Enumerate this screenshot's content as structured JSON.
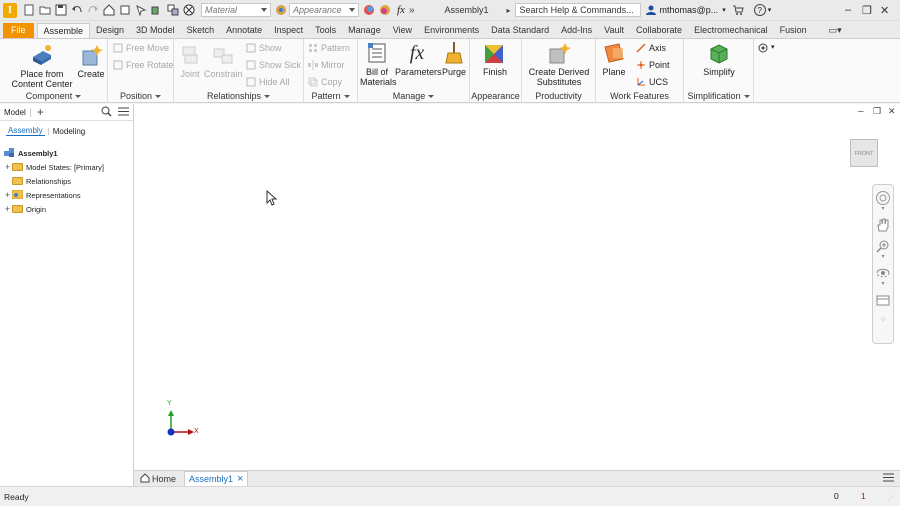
{
  "title_bar": {
    "logo": "I",
    "material_placeholder": "Material",
    "appearance_placeholder": "Appearance",
    "fx": "fx",
    "more": "»",
    "doc_title": "Assembly1",
    "search": "Search Help & Commands...",
    "user": "mthomas@p...",
    "help": "?"
  },
  "tabs": [
    "File",
    "Assemble",
    "Design",
    "3D Model",
    "Sketch",
    "Annotate",
    "Inspect",
    "Tools",
    "Manage",
    "View",
    "Environments",
    "Data Standard",
    "Add-Ins",
    "Vault",
    "Collaborate",
    "Electromechanical",
    "Fusion"
  ],
  "ribbon": {
    "component": {
      "label": "Component",
      "place": "Place from\nContent Center",
      "create": "Create"
    },
    "position": {
      "label": "Position",
      "free_move": "Free Move",
      "free_rotate": "Free Rotate"
    },
    "relationships": {
      "label": "Relationships",
      "joint": "Joint",
      "constrain": "Constrain",
      "show": "Show",
      "show_sick": "Show Sick",
      "hide_all": "Hide All"
    },
    "pattern": {
      "label": "Pattern",
      "pattern": "Pattern",
      "mirror": "Mirror",
      "copy": "Copy"
    },
    "manage": {
      "label": "Manage",
      "bom": "Bill of\nMaterials",
      "parameters": "Parameters",
      "purge": "Purge"
    },
    "appearance": {
      "label": "Appearance",
      "finish": "Finish"
    },
    "productivity": {
      "label": "Productivity",
      "derived": "Create Derived\nSubstitutes"
    },
    "work_features": {
      "label": "Work Features",
      "plane": "Plane",
      "axis": "Axis",
      "point": "Point",
      "ucs": "UCS"
    },
    "simplification": {
      "label": "Simplification",
      "simplify": "Simplify"
    }
  },
  "browser": {
    "title": "Model",
    "add": "+",
    "tab_assembly": "Assembly",
    "tab_modeling": "Modeling",
    "root": "Assembly1",
    "nodes": [
      "Model States: [Primary]",
      "Relationships",
      "Representations",
      "Origin"
    ]
  },
  "canvas": {
    "viewcube": "FRONT",
    "axis_x": "X",
    "axis_y": "Y"
  },
  "doc_tabs": {
    "home": "Home",
    "doc": "Assembly1",
    "close": "×"
  },
  "status": {
    "text": "Ready",
    "count1": "0",
    "count2": "1"
  },
  "colors": {
    "file_tab": "#f39200",
    "active_link": "#1a6fbf",
    "axis_x": "#b01010",
    "axis_y": "#20a020",
    "origin": "#1030c0"
  }
}
